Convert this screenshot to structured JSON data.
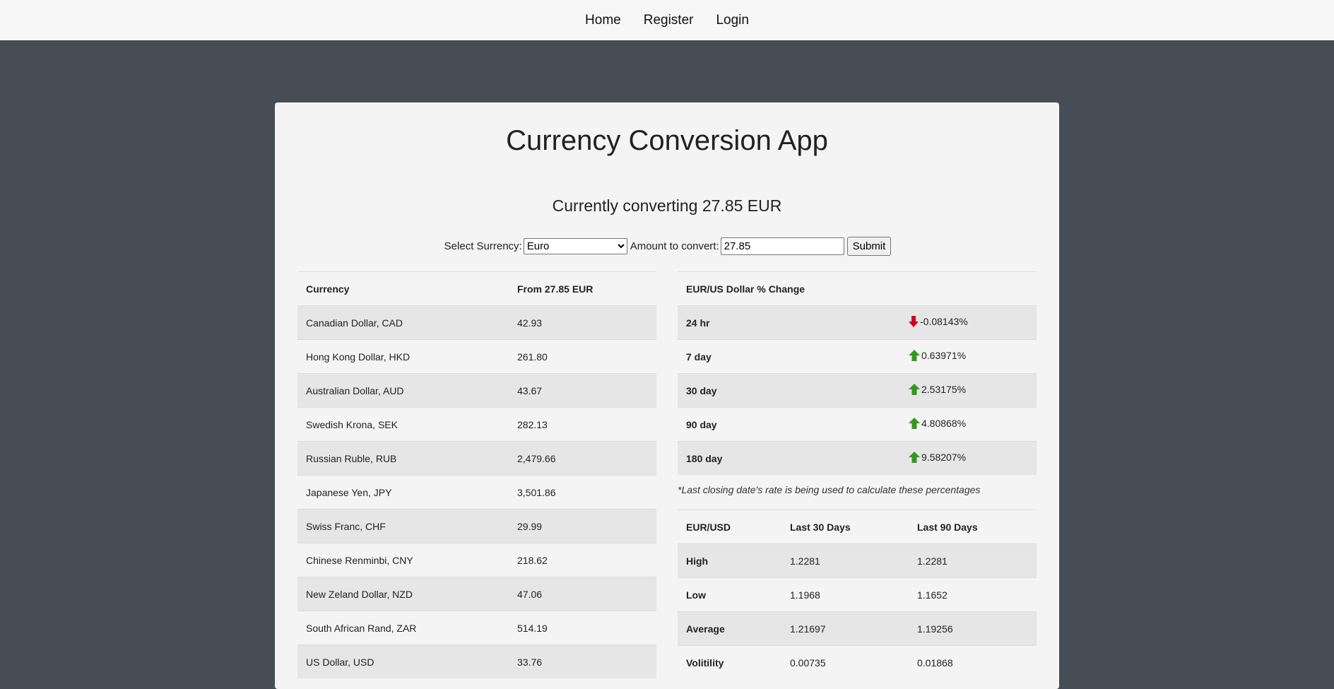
{
  "nav": {
    "home": "Home",
    "register": "Register",
    "login": "Login"
  },
  "title": "Currency Conversion App",
  "subtitle": "Currently converting 27.85 EUR",
  "form": {
    "select_label": "Select Surrency:",
    "selected_currency": "Euro",
    "amount_label": "Amount to convert:",
    "amount_value": "27.85",
    "submit_label": "Submit"
  },
  "conversion": {
    "headers": [
      "Currency",
      "From 27.85 EUR"
    ],
    "rows": [
      [
        "Canadian Dollar, CAD",
        "42.93"
      ],
      [
        "Hong Kong Dollar, HKD",
        "261.80"
      ],
      [
        "Australian Dollar, AUD",
        "43.67"
      ],
      [
        "Swedish Krona, SEK",
        "282.13"
      ],
      [
        "Russian Ruble, RUB",
        "2,479.66"
      ],
      [
        "Japanese Yen, JPY",
        "3,501.86"
      ],
      [
        "Swiss Franc, CHF",
        "29.99"
      ],
      [
        "Chinese Renminbi, CNY",
        "218.62"
      ],
      [
        "New Zeland Dollar, NZD",
        "47.06"
      ],
      [
        "South African Rand, ZAR",
        "514.19"
      ],
      [
        "US Dollar, USD",
        "33.76"
      ]
    ]
  },
  "change": {
    "header": "EUR/US Dollar % Change",
    "rows": [
      {
        "period": "24 hr",
        "value": "-0.08143%",
        "direction": "down"
      },
      {
        "period": "7 day",
        "value": "0.63971%",
        "direction": "up"
      },
      {
        "period": "30 day",
        "value": "2.53175%",
        "direction": "up"
      },
      {
        "period": "90 day",
        "value": "4.80868%",
        "direction": "up"
      },
      {
        "period": "180 day",
        "value": "9.58207%",
        "direction": "up"
      }
    ],
    "colors": {
      "up": "#2f9a1e",
      "down": "#d0021b"
    }
  },
  "note": "*Last closing date's rate is being used to calculate these percentages",
  "stats": {
    "headers": [
      "EUR/USD",
      "Last 30 Days",
      "Last 90 Days"
    ],
    "rows": [
      [
        "High",
        "1.2281",
        "1.2281"
      ],
      [
        "Low",
        "1.1968",
        "1.1652"
      ],
      [
        "Average",
        "1.21697",
        "1.19256"
      ],
      [
        "Volitility",
        "0.00735",
        "0.01868"
      ]
    ]
  }
}
